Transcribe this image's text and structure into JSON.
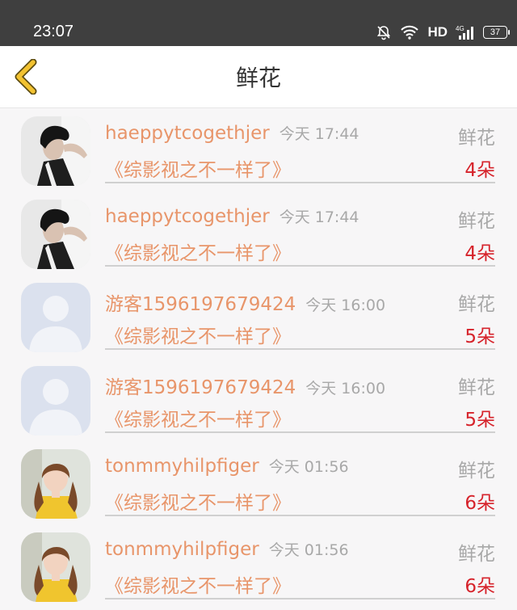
{
  "status_bar": {
    "time": "23:07",
    "icons": [
      "bell-mute-icon",
      "wifi-icon",
      "signal-4g-icon",
      "battery-icon"
    ],
    "network_label": "HD",
    "battery": "37"
  },
  "header": {
    "back_icon": "chevron-left-icon",
    "title": "鲜花"
  },
  "colors": {
    "accent": "#e8956a",
    "count": "#d6232b",
    "muted": "#a8a8a8",
    "back_arrow": "#f2c230"
  },
  "rows": [
    {
      "avatar": "avatar-man-photo",
      "username": "haeppytcogethjer",
      "time": "今天 17:44",
      "gift": "鲜花",
      "book": "《综影视之不一样了》",
      "count": "4朵"
    },
    {
      "avatar": "avatar-man-photo",
      "username": "haeppytcogethjer",
      "time": "今天 17:44",
      "gift": "鲜花",
      "book": "《综影视之不一样了》",
      "count": "4朵"
    },
    {
      "avatar": "avatar-default-silhouette",
      "username": "游客1596197679424",
      "time": "今天 16:00",
      "gift": "鲜花",
      "book": "《综影视之不一样了》",
      "count": "5朵"
    },
    {
      "avatar": "avatar-default-silhouette",
      "username": "游客1596197679424",
      "time": "今天 16:00",
      "gift": "鲜花",
      "book": "《综影视之不一样了》",
      "count": "5朵"
    },
    {
      "avatar": "avatar-girl-photo",
      "username": "tonmmyhilpfiger",
      "time": "今天 01:56",
      "gift": "鲜花",
      "book": "《综影视之不一样了》",
      "count": "6朵"
    },
    {
      "avatar": "avatar-girl-photo",
      "username": "tonmmyhilpfiger",
      "time": "今天 01:56",
      "gift": "鲜花",
      "book": "《综影视之不一样了》",
      "count": "6朵"
    }
  ]
}
